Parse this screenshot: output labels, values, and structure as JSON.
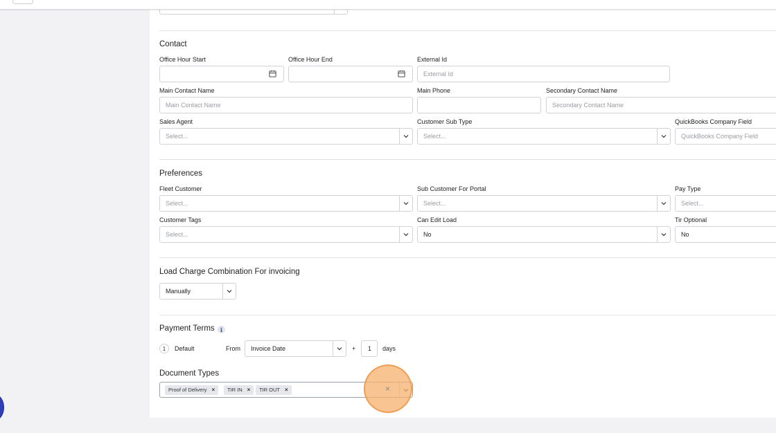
{
  "contact": {
    "title": "Contact",
    "office_hour_start": {
      "label": "Office Hour Start",
      "value": ""
    },
    "office_hour_end": {
      "label": "Office Hour End",
      "value": ""
    },
    "external_id": {
      "label": "External Id",
      "placeholder": "External Id"
    },
    "main_contact_name": {
      "label": "Main Contact Name",
      "placeholder": "Main Contact Name"
    },
    "main_phone": {
      "label": "Main Phone",
      "value": ""
    },
    "secondary_contact_name": {
      "label": "Secondary Contact Name",
      "placeholder": "Secondary Contact Name"
    },
    "sales_agent": {
      "label": "Sales Agent",
      "placeholder": "Select..."
    },
    "customer_sub_type": {
      "label": "Customer Sub Type",
      "placeholder": "Select..."
    },
    "quickbooks_company_field": {
      "label": "QuickBooks Company Field",
      "placeholder": "QuickBooks Company Field"
    }
  },
  "preferences": {
    "title": "Preferences",
    "fleet_customer": {
      "label": "Fleet Customer",
      "placeholder": "Select..."
    },
    "sub_customer_for_portal": {
      "label": "Sub Customer For Portal",
      "placeholder": "Select..."
    },
    "pay_type": {
      "label": "Pay Type",
      "placeholder": "Select..."
    },
    "customer_tags": {
      "label": "Customer Tags",
      "placeholder": "Select..."
    },
    "can_edit_load": {
      "label": "Can Edit Load",
      "value": "No"
    },
    "tir_optional": {
      "label": "Tir Optional",
      "value": "No"
    }
  },
  "load_charge": {
    "title": "Load Charge Combination For invoicing",
    "value": "Manually"
  },
  "payment_terms": {
    "title": "Payment Terms",
    "info_icon": "info-icon",
    "step": "1",
    "default_label": "Default",
    "from_label": "From",
    "from_value": "Invoice Date",
    "plus": "+",
    "days_value": "1",
    "days_label": "days"
  },
  "document_types": {
    "title": "Document Types",
    "tags": [
      "Proof of Delivery",
      "TIR IN",
      "TIR OUT"
    ],
    "clear_icon": "×"
  },
  "colors": {
    "highlight": "#f6b16e",
    "accent_blue": "#2f3fb8"
  }
}
